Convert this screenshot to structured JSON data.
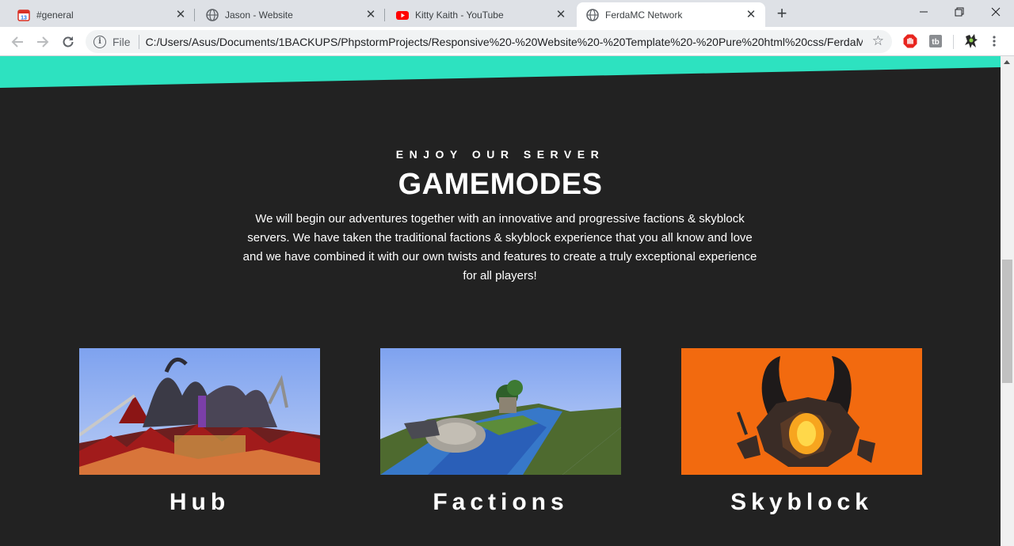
{
  "browser": {
    "tabs": [
      {
        "title": "#general",
        "icon": "discord-calendar-icon",
        "active": false
      },
      {
        "title": "Jason - Website",
        "icon": "globe-icon",
        "active": false
      },
      {
        "title": "Kitty Kaith - YouTube",
        "icon": "youtube-icon",
        "active": false
      },
      {
        "title": "FerdaMC Network",
        "icon": "globe-icon",
        "active": true
      }
    ],
    "new_tab": "+",
    "omnibox": {
      "scheme_label": "File",
      "url": "C:/Users/Asus/Documents/1BACKUPS/PhpstormProjects/Responsive%20-%20Website%20-%20Template%20-%20Pure%20html%20css/FerdaMC..."
    },
    "accent_color": "#dee1e6"
  },
  "page": {
    "accent_color": "#2de2c0",
    "background_color": "#222222",
    "eyebrow": "ENJOY OUR SERVER",
    "heading": "GAMEMODES",
    "intro": "We will begin our adventures together with an innovative and progressive factions & skyblock servers. We have taken the traditional factions & skyblock experience that you all know and love and we have combined it with our own twists and features to create a truly exceptional experience for all players!",
    "gamemodes": [
      {
        "label": "Hub",
        "image": "hub-screenshot"
      },
      {
        "label": "Factions",
        "image": "factions-screenshot"
      },
      {
        "label": "Skyblock",
        "image": "skyblock-screenshot"
      }
    ]
  }
}
